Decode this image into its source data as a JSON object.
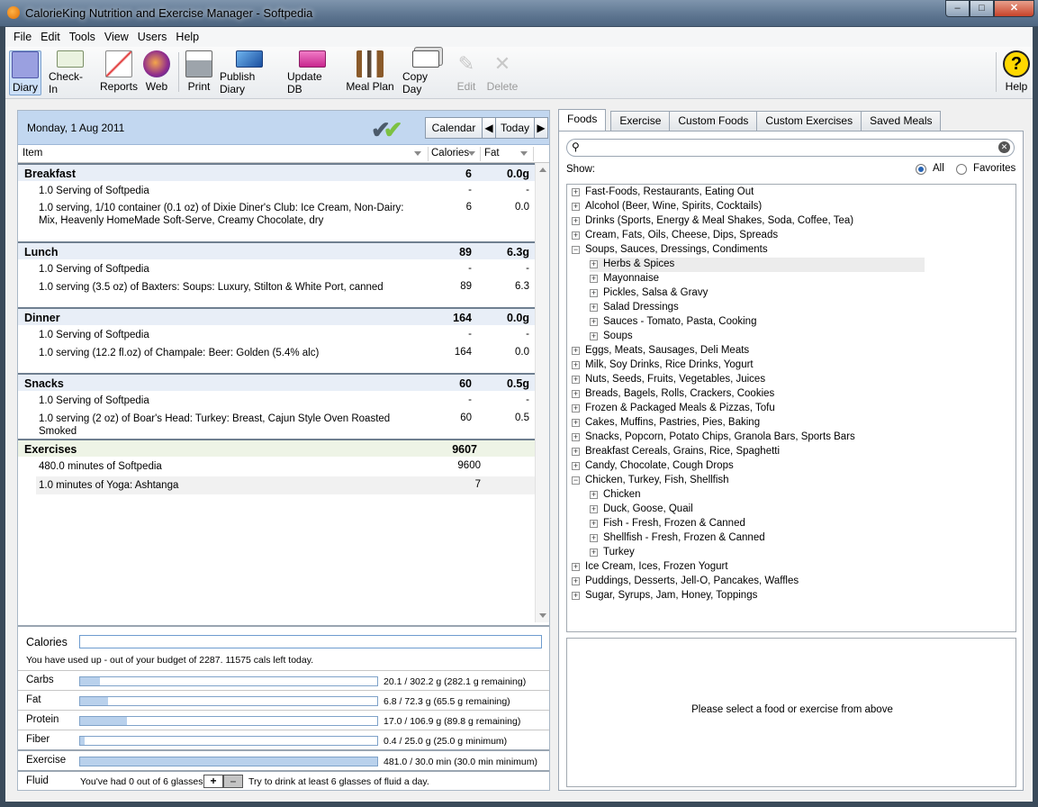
{
  "window": {
    "title": "CalorieKing Nutrition and Exercise Manager - Softpedia",
    "min": "–",
    "max": "□",
    "close": "✕"
  },
  "menu": [
    "File",
    "Edit",
    "Tools",
    "View",
    "Users",
    "Help"
  ],
  "toolbar": {
    "diary": "Diary",
    "checkin": "Check-In",
    "reports": "Reports",
    "web": "Web",
    "print": "Print",
    "publish": "Publish Diary",
    "update": "Update DB",
    "mealplan": "Meal Plan",
    "copyday": "Copy Day",
    "edit": "Edit",
    "delete": "Delete",
    "help": "Help"
  },
  "diary": {
    "date": "Monday, 1 Aug 2011",
    "calendar": "Calendar",
    "today": "Today",
    "col_item": "Item",
    "col_calories": "Calories",
    "col_fat": "Fat",
    "breakfast": {
      "name": "Breakfast",
      "cal": "6",
      "fat": "0.0g",
      "rows": [
        {
          "item": "1.0 Serving of Softpedia",
          "cal": "-",
          "fat": "-"
        },
        {
          "item": "1.0 serving, 1/10 container (0.1 oz) of Dixie Diner's Club: Ice Cream, Non-Dairy: Mix, Heavenly HomeMade Soft-Serve, Creamy Chocolate, dry",
          "cal": "6",
          "fat": "0.0"
        }
      ]
    },
    "lunch": {
      "name": "Lunch",
      "cal": "89",
      "fat": "6.3g",
      "rows": [
        {
          "item": "1.0 Serving of Softpedia",
          "cal": "-",
          "fat": "-"
        },
        {
          "item": "1.0 serving (3.5 oz) of Baxters: Soups: Luxury, Stilton & White Port, canned",
          "cal": "89",
          "fat": "6.3"
        }
      ]
    },
    "dinner": {
      "name": "Dinner",
      "cal": "164",
      "fat": "0.0g",
      "rows": [
        {
          "item": "1.0 Serving of Softpedia",
          "cal": "-",
          "fat": "-"
        },
        {
          "item": "1.0 serving (12.2 fl.oz) of Champale: Beer: Golden (5.4% alc)",
          "cal": "164",
          "fat": "0.0"
        }
      ]
    },
    "snacks": {
      "name": "Snacks",
      "cal": "60",
      "fat": "0.5g",
      "rows": [
        {
          "item": "1.0 Serving of Softpedia",
          "cal": "-",
          "fat": "-"
        },
        {
          "item": "1.0 serving (2 oz) of Boar's Head: Turkey: Breast, Cajun Style Oven Roasted Smoked",
          "cal": "60",
          "fat": "0.5"
        }
      ]
    },
    "exercises": {
      "name": "Exercises",
      "cal": "9607",
      "rows": [
        {
          "item": "480.0 minutes of Softpedia",
          "cal": "9600"
        },
        {
          "item": "1.0 minutes of Yoga: Ashtanga",
          "cal": "7"
        }
      ]
    }
  },
  "summary": {
    "calories_label": "Calories",
    "calories_text": "You have used up - out of your budget of 2287. 11575 cals left today.",
    "carbs": {
      "label": "Carbs",
      "text": "20.1 / 302.2 g (282.1 g remaining)",
      "fraction": 0.066
    },
    "fat": {
      "label": "Fat",
      "text": "6.8 / 72.3 g (65.5 g remaining)",
      "fraction": 0.094
    },
    "protein": {
      "label": "Protein",
      "text": "17.0 / 106.9 g (89.8 g remaining)",
      "fraction": 0.159
    },
    "fiber": {
      "label": "Fiber",
      "text": "0.4 / 25.0 g (25.0 g minimum)",
      "fraction": 0.016
    },
    "exercise": {
      "label": "Exercise",
      "text": "481.0 / 30.0 min (30.0 min minimum)",
      "fraction": 1.0
    },
    "fluid": {
      "label": "Fluid",
      "text1": "You've had  0 out of 6 glasses.",
      "plus": "+",
      "minus": "–",
      "text2": "Try to drink at least 6 glasses of fluid a day."
    }
  },
  "foods": {
    "tabs": [
      "Foods",
      "Exercise",
      "Custom Foods",
      "Custom Exercises",
      "Saved Meals"
    ],
    "show_label": "Show:",
    "all": "All",
    "favorites": "Favorites",
    "tree": [
      {
        "label": "Fast-Foods, Restaurants, Eating Out",
        "level": 0,
        "exp": "+"
      },
      {
        "label": "Alcohol (Beer, Wine, Spirits, Cocktails)",
        "level": 0,
        "exp": "+"
      },
      {
        "label": "Drinks (Sports, Energy & Meal Shakes, Soda, Coffee, Tea)",
        "level": 0,
        "exp": "+"
      },
      {
        "label": "Cream, Fats, Oils, Cheese, Dips, Spreads",
        "level": 0,
        "exp": "+"
      },
      {
        "label": "Soups, Sauces, Dressings, Condiments",
        "level": 0,
        "exp": "−"
      },
      {
        "label": "Herbs & Spices",
        "level": 1,
        "exp": "+",
        "selected": true
      },
      {
        "label": "Mayonnaise",
        "level": 1,
        "exp": "+"
      },
      {
        "label": "Pickles, Salsa & Gravy",
        "level": 1,
        "exp": "+"
      },
      {
        "label": "Salad Dressings",
        "level": 1,
        "exp": "+"
      },
      {
        "label": "Sauces - Tomato, Pasta, Cooking",
        "level": 1,
        "exp": "+"
      },
      {
        "label": "Soups",
        "level": 1,
        "exp": "+"
      },
      {
        "label": "Eggs, Meats, Sausages, Deli Meats",
        "level": 0,
        "exp": "+"
      },
      {
        "label": "Milk, Soy Drinks, Rice Drinks, Yogurt",
        "level": 0,
        "exp": "+"
      },
      {
        "label": "Nuts, Seeds, Fruits, Vegetables, Juices",
        "level": 0,
        "exp": "+"
      },
      {
        "label": "Breads, Bagels, Rolls, Crackers, Cookies",
        "level": 0,
        "exp": "+"
      },
      {
        "label": "Frozen & Packaged Meals & Pizzas, Tofu",
        "level": 0,
        "exp": "+"
      },
      {
        "label": "Cakes, Muffins, Pastries, Pies, Baking",
        "level": 0,
        "exp": "+"
      },
      {
        "label": "Snacks, Popcorn, Potato Chips, Granola Bars, Sports Bars",
        "level": 0,
        "exp": "+"
      },
      {
        "label": "Breakfast Cereals, Grains, Rice, Spaghetti",
        "level": 0,
        "exp": "+"
      },
      {
        "label": "Candy, Chocolate, Cough Drops",
        "level": 0,
        "exp": "+"
      },
      {
        "label": "Chicken, Turkey, Fish, Shellfish",
        "level": 0,
        "exp": "−"
      },
      {
        "label": "Chicken",
        "level": 1,
        "exp": "+"
      },
      {
        "label": "Duck, Goose, Quail",
        "level": 1,
        "exp": "+"
      },
      {
        "label": "Fish - Fresh, Frozen & Canned",
        "level": 1,
        "exp": "+"
      },
      {
        "label": "Shellfish - Fresh, Frozen & Canned",
        "level": 1,
        "exp": "+"
      },
      {
        "label": "Turkey",
        "level": 1,
        "exp": "+"
      },
      {
        "label": "Ice Cream, Ices, Frozen Yogurt",
        "level": 0,
        "exp": "+"
      },
      {
        "label": "Puddings, Desserts, Jell-O, Pancakes, Waffles",
        "level": 0,
        "exp": "+"
      },
      {
        "label": "Sugar, Syrups, Jam, Honey, Toppings",
        "level": 0,
        "exp": "+"
      }
    ],
    "detail_message": "Please select a food or exercise from above"
  },
  "colors": {
    "accent": "#c2d7f0",
    "bar_fill": "#b9d1ec",
    "check_dark": "#4c5b6b",
    "check_green": "#7cc142"
  }
}
